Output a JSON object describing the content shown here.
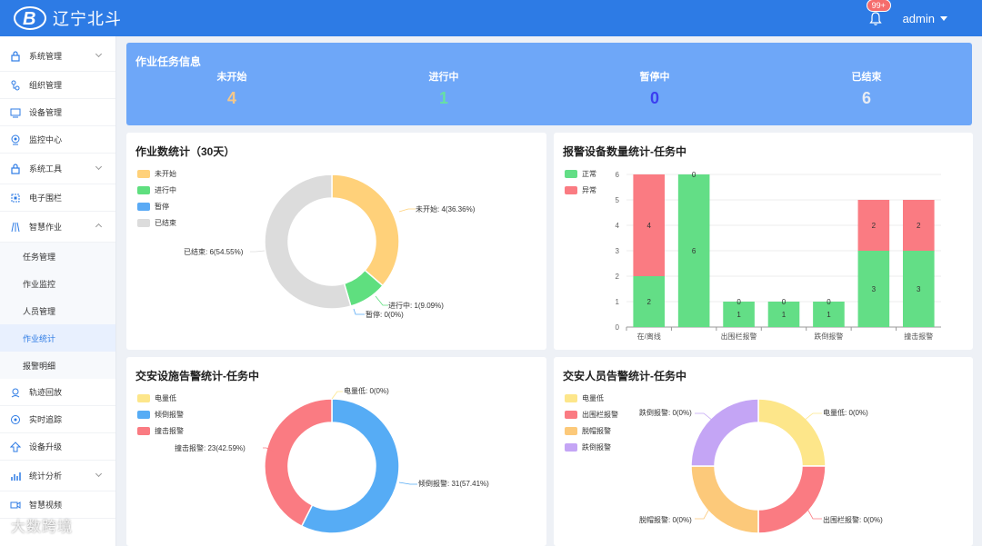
{
  "app": {
    "brand": "辽宁北斗",
    "notifications": "99+",
    "user": "admin"
  },
  "sidebar": {
    "items": [
      {
        "label": "系统管理",
        "icon": "lock-icon"
      },
      {
        "label": "组织管理",
        "icon": "org-icon"
      },
      {
        "label": "设备管理",
        "icon": "device-icon"
      },
      {
        "label": "监控中心",
        "icon": "monitor-icon"
      },
      {
        "label": "系统工具",
        "icon": "lock-icon"
      },
      {
        "label": "电子围栏",
        "icon": "fence-icon"
      },
      {
        "label": "智慧作业",
        "icon": "work-icon"
      },
      {
        "label": "轨迹回放",
        "icon": "track-icon"
      },
      {
        "label": "实时追踪",
        "icon": "target-icon"
      },
      {
        "label": "设备升级",
        "icon": "upgrade-icon"
      },
      {
        "label": "统计分析",
        "icon": "stats-icon"
      },
      {
        "label": "智慧视频",
        "icon": "video-icon"
      }
    ],
    "sub_items": [
      {
        "label": "任务管理"
      },
      {
        "label": "作业监控"
      },
      {
        "label": "人员管理"
      },
      {
        "label": "作业统计"
      },
      {
        "label": "报警明细"
      }
    ]
  },
  "banner": {
    "title": "作业任务信息",
    "stats": [
      {
        "label": "未开始",
        "value": "4",
        "color": "#f5c88a"
      },
      {
        "label": "进行中",
        "value": "1",
        "color": "#67e0a3"
      },
      {
        "label": "暂停中",
        "value": "0",
        "color": "#3b3ff0"
      },
      {
        "label": "已结束",
        "value": "6",
        "color": "#e8ecf3"
      }
    ]
  },
  "cards": {
    "work_stats": {
      "title": "作业数统计（30天）",
      "legend": [
        {
          "label": "未开始",
          "color": "#ffd17a"
        },
        {
          "label": "进行中",
          "color": "#5fdf7f"
        },
        {
          "label": "暂停",
          "color": "#5aaaf5"
        },
        {
          "label": "已结束",
          "color": "#dcdcdc"
        }
      ],
      "labels": {
        "not_started": "未开始: 4(36.36%)",
        "in_progress": "进行中: 1(9.09%)",
        "paused": "暂停: 0(0%)",
        "ended": "已结束: 6(54.55%)"
      }
    },
    "alarm_devices": {
      "title": "报警设备数量统计-任务中",
      "legend": [
        {
          "label": "正常",
          "color": "#63de86"
        },
        {
          "label": "异常",
          "color": "#fa7b82"
        }
      ]
    },
    "facility_alarm": {
      "title": "交安设施告警统计-任务中",
      "legend": [
        {
          "label": "电量低",
          "color": "#fde68a"
        },
        {
          "label": "倾倒报警",
          "color": "#56acf5"
        },
        {
          "label": "撞击报警",
          "color": "#fa7b82"
        }
      ],
      "labels": {
        "low_battery": "电量低: 0(0%)",
        "tilt": "倾倒报警: 31(57.41%)",
        "impact": "撞击报警: 23(42.59%)"
      }
    },
    "personnel_alarm": {
      "title": "交安人员告警统计-任务中",
      "legend": [
        {
          "label": "电量低",
          "color": "#fde68a"
        },
        {
          "label": "出围栏报警",
          "color": "#fa7b82"
        },
        {
          "label": "脱帽报警",
          "color": "#fcc97a"
        },
        {
          "label": "跌倒报警",
          "color": "#c4a5f5"
        }
      ],
      "labels": {
        "low_battery": "电量低: 0(0%)",
        "out_fence": "出围栏报警: 0(0%)",
        "helmet_off": "脱帽报警: 0(0%)",
        "fall": "跌倒报警: 0(0%)"
      }
    }
  },
  "chart_data": [
    {
      "type": "pie",
      "title": "作业数统计（30天）",
      "categories": [
        "未开始",
        "进行中",
        "暂停",
        "已结束"
      ],
      "values": [
        4,
        1,
        0,
        6
      ]
    },
    {
      "type": "bar",
      "stacked": true,
      "title": "报警设备数量统计-任务中",
      "categories": [
        "在/离线",
        "",
        "出围栏报警",
        "",
        "跌倒报警",
        "",
        "撞击报警"
      ],
      "series": [
        {
          "name": "正常",
          "values": [
            2,
            6,
            1,
            1,
            1,
            3,
            3
          ]
        },
        {
          "name": "异常",
          "values": [
            4,
            0,
            0,
            0,
            0,
            2,
            2
          ]
        }
      ],
      "ylim": [
        0,
        6
      ]
    },
    {
      "type": "pie",
      "title": "交安设施告警统计-任务中",
      "categories": [
        "电量低",
        "倾倒报警",
        "撞击报警"
      ],
      "values": [
        0,
        31,
        23
      ]
    },
    {
      "type": "pie",
      "title": "交安人员告警统计-任务中",
      "categories": [
        "电量低",
        "出围栏报警",
        "脱帽报警",
        "跌倒报警"
      ],
      "values": [
        0,
        0,
        0,
        0
      ]
    }
  ],
  "watermark": "大数跨境"
}
